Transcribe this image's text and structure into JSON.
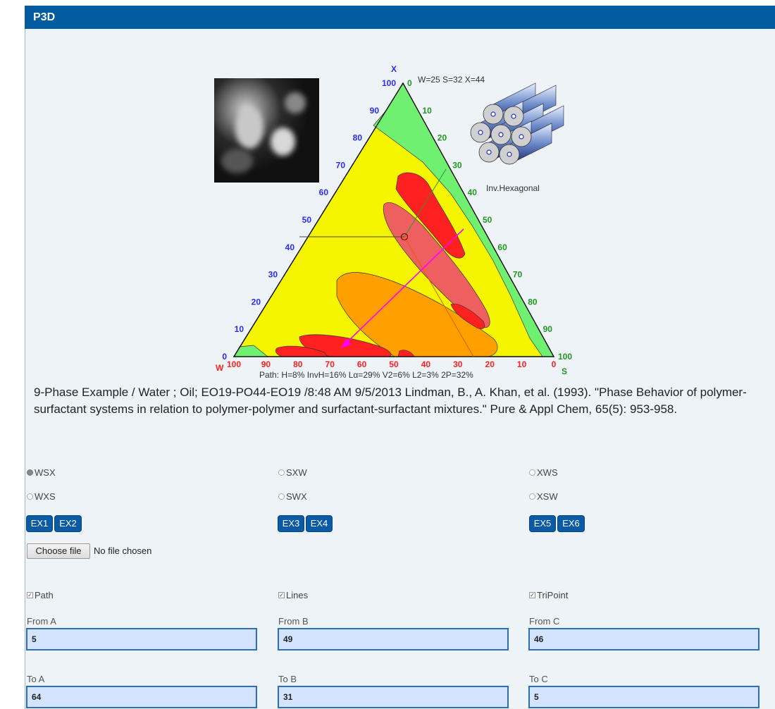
{
  "app": {
    "title": "P3D"
  },
  "diagram": {
    "apex_labels": {
      "top": "X",
      "left": "W",
      "right": "S"
    },
    "composition": "W=25 S=32 X=44",
    "structure_caption": "Inv.Hexagonal",
    "path_summary": "Path: H=8% InvH=16% Lα=29% V2=6% L2=3% 2P=32%",
    "left_ticks": [
      "0",
      "10",
      "20",
      "30",
      "40",
      "50",
      "60",
      "70",
      "80",
      "90",
      "100"
    ],
    "right_ticks": [
      "0",
      "10",
      "20",
      "30",
      "40",
      "50",
      "60",
      "70",
      "80",
      "90",
      "100"
    ],
    "bottom_ticks": [
      "100",
      "90",
      "80",
      "70",
      "60",
      "50",
      "40",
      "30",
      "20",
      "10",
      "0"
    ],
    "colors": {
      "W": "#0000ff",
      "S": "#008800",
      "X": "#0000ff",
      "region_main": "#f5f500",
      "region_green": "#70f070",
      "region_red": "#ff2020",
      "region_salmon": "#ee6060",
      "region_orange": "#ffa000",
      "path_line": "#ff00ff"
    }
  },
  "citation": "9-Phase Example / Water ; Oil; EO19-PO44-EO19 /8:48 AM 9/5/2013 Lindman, B., A. Khan, et al. (1993). \"Phase Behavior of polymer-surfactant systems in relation to polymer-polymer and surfactant-surfactant mixtures.\" Pure & Appl Chem, 65(5): 953-958.",
  "orderings": {
    "col1": [
      "WSX",
      "WXS"
    ],
    "col2": [
      "SXW",
      "SWX"
    ],
    "col3": [
      "XWS",
      "XSW"
    ],
    "selected": "WSX"
  },
  "examples": [
    "EX1",
    "EX2",
    "EX3",
    "EX4",
    "EX5",
    "EX6"
  ],
  "file": {
    "button": "Choose file",
    "status": "No file chosen"
  },
  "options": {
    "path": "Path",
    "lines": "Lines",
    "tripoint": "TriPoint"
  },
  "from": {
    "a_label": "From A",
    "a": "5",
    "b_label": "From B",
    "b": "49",
    "c_label": "From C",
    "c": "46"
  },
  "to": {
    "a_label": "To A",
    "a": "64",
    "b_label": "To B",
    "b": "31",
    "c_label": "To C",
    "c": "5"
  }
}
